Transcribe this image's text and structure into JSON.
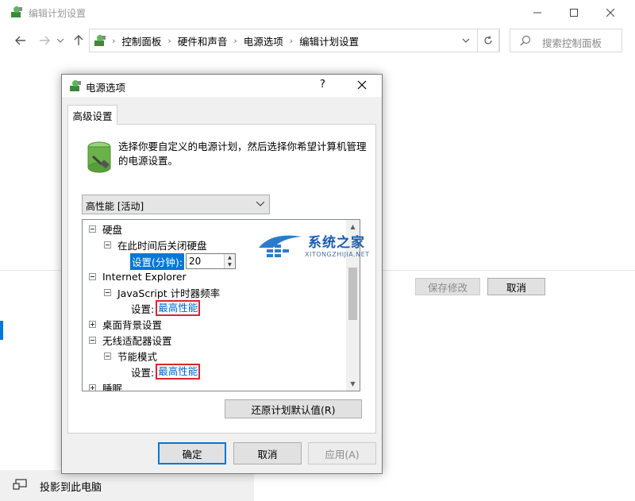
{
  "main_window": {
    "title": "编辑计划设置",
    "breadcrumbs": [
      "控制面板",
      "硬件和声音",
      "电源选项",
      "编辑计划设置"
    ],
    "search_placeholder": "搜索控制面板",
    "save_label": "保存修改",
    "cancel_label": "取消",
    "project_label": "投影到此电脑"
  },
  "dialog": {
    "title": "电源选项",
    "help": "?",
    "tab": "高级设置",
    "description": "选择你要自定义的电源计划，然后选择你希望计算机管理的电源设置。",
    "plan": "高性能 [活动]",
    "tree": {
      "hard_disk": "硬盘",
      "turn_off_disk": "在此时间后关闭硬盘",
      "setting_minutes_label": "设置(分钟):",
      "setting_minutes_value": "20",
      "ie": "Internet Explorer",
      "js_timer": "JavaScript 计时器频率",
      "setting_label": "设置:",
      "js_value": "最高性能",
      "desktop_bg": "桌面背景设置",
      "wireless": "无线适配器设置",
      "power_save": "节能模式",
      "wireless_value": "最高性能",
      "sleep": "睡眠"
    },
    "restore_label": "还原计划默认值(R)",
    "ok_label": "确定",
    "cancel_label": "取消",
    "apply_label": "应用(A)"
  },
  "watermark": {
    "title": "系统之家",
    "url": "XITONGZHIJIA.NET"
  },
  "colors": {
    "accent": "#0078d7",
    "highlight_border": "#d9262c",
    "link": "#0066cc"
  }
}
